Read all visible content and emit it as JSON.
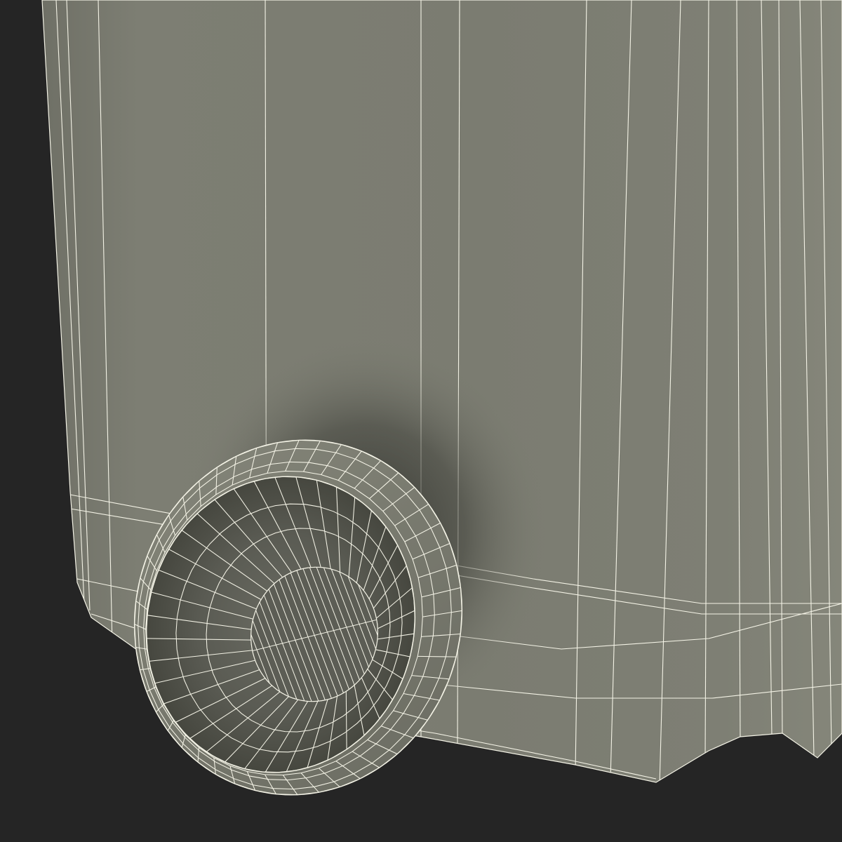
{
  "scene": {
    "subject": "wireframe-render",
    "colors": {
      "background": "#252525",
      "body": "#7c7d72",
      "body_light": "#868779",
      "body_dark": "#6e6f65",
      "cap_inner": "#5f6058",
      "cap_deep": "#4e4f48",
      "wire": "#f4f3e6"
    }
  }
}
